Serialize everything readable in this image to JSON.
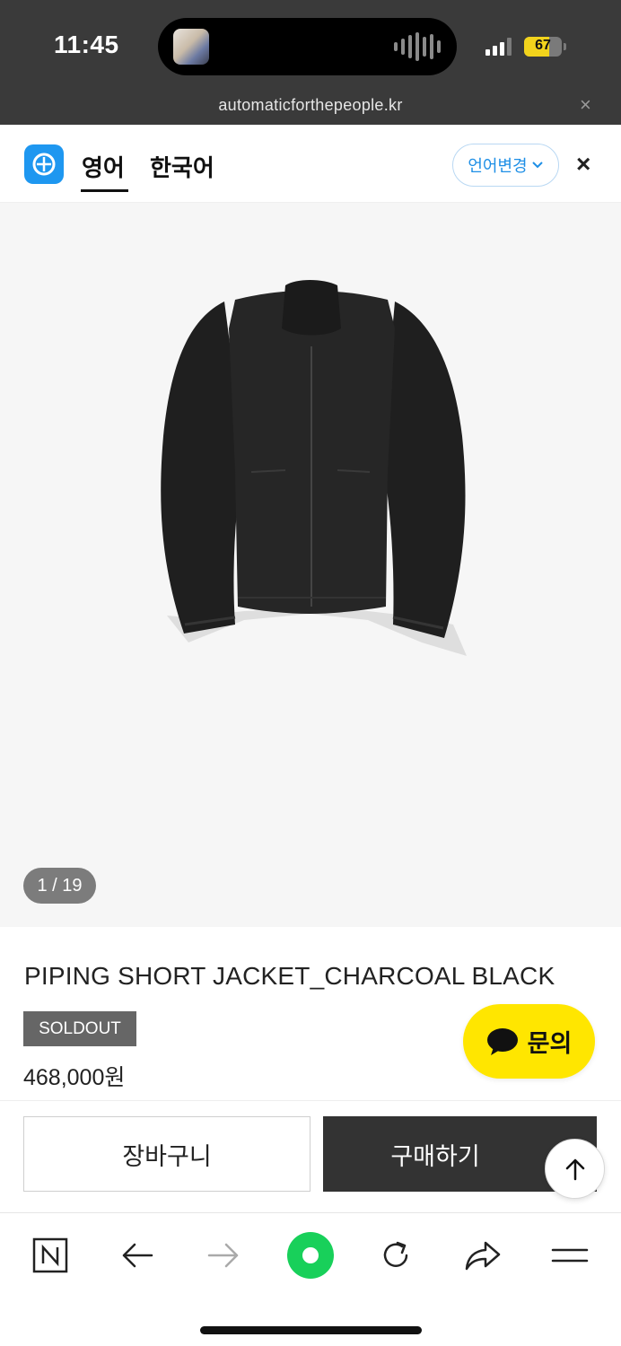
{
  "status_bar": {
    "time": "11:45",
    "battery": "67",
    "battery_level": 0.67
  },
  "browser": {
    "url": "automaticforthepeople.kr",
    "url_close": "×"
  },
  "translate_bar": {
    "tabs": [
      {
        "label": "영어",
        "active": true
      },
      {
        "label": "한국어",
        "active": false
      }
    ],
    "change_language_label": "언어변경",
    "close": "×"
  },
  "product": {
    "image_counter": "1 / 19",
    "title": "PIPING SHORT JACKET_CHARCOAL BLACK",
    "badge": "SOLDOUT",
    "price": "468,000원"
  },
  "inquiry_button": {
    "label": "문의"
  },
  "actions": {
    "cart_label": "장바구니",
    "buy_label": "구매하기"
  },
  "colors": {
    "status_bg": "#3a3a3a",
    "accent_blue": "#1e97f0",
    "inquiry_yellow": "#ffe600",
    "buy_button": "#333333",
    "toolbar_green": "#18d05a"
  },
  "toolbar_icons": [
    "naver-n-icon",
    "back-arrow-icon",
    "forward-arrow-icon",
    "green-home-icon",
    "reload-icon",
    "share-icon",
    "menu-icon"
  ]
}
